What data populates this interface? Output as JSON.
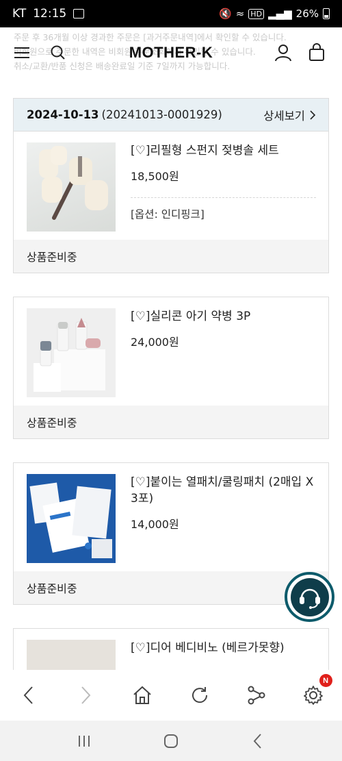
{
  "status_bar": {
    "carrier": "KT",
    "time": "12:15",
    "battery": "26%"
  },
  "header": {
    "logo": "MOTHER-K",
    "notice_lines": [
      "주문 후 36개월 이상 경과한 주문은 [과거주문내역]에서 확인할 수 있습니다.",
      "비회원으로 주문한 내역은 비회원 주문조회에서 확인할 수 있습니다.",
      "취소/교환/반품 신청은 배송완료일 기준 7일까지 가능합니다."
    ]
  },
  "order": {
    "date": "2024-10-13",
    "order_no": "(20241013-0001929)",
    "detail_label": "상세보기"
  },
  "items": [
    {
      "name": "[♡]리필형 스펀지 젖병솔 세트",
      "price": "18,500원",
      "option": "[옵션: 인디핑크]",
      "status": "상품준비중"
    },
    {
      "name": "[♡]실리콘 아기 약병 3P",
      "price": "24,000원",
      "option": "",
      "status": "상품준비중"
    },
    {
      "name": "[♡]붙이는 열패치/쿨링패치 (2매입 X 3포)",
      "price": "14,000원",
      "option": "",
      "status": "상품준비중"
    },
    {
      "name": "[♡]디어 베디비노 (베르가못향)",
      "price": "",
      "option": "",
      "status": ""
    }
  ],
  "browser_bar": {
    "settings_badge": "N"
  },
  "colors": {
    "card_header_bg": "#e8f0f4",
    "status_bg": "#f4f4f4",
    "chat_ring": "#0d5b6b",
    "badge": "#e0201b"
  },
  "icons": [
    "menu-icon",
    "search-icon",
    "user-icon",
    "bag-icon",
    "chevron-right-icon",
    "headset-icon",
    "back-icon",
    "forward-icon",
    "home-icon",
    "reload-icon",
    "share-icon",
    "gear-icon",
    "recents-icon",
    "home-circle-icon",
    "nav-back-icon"
  ]
}
